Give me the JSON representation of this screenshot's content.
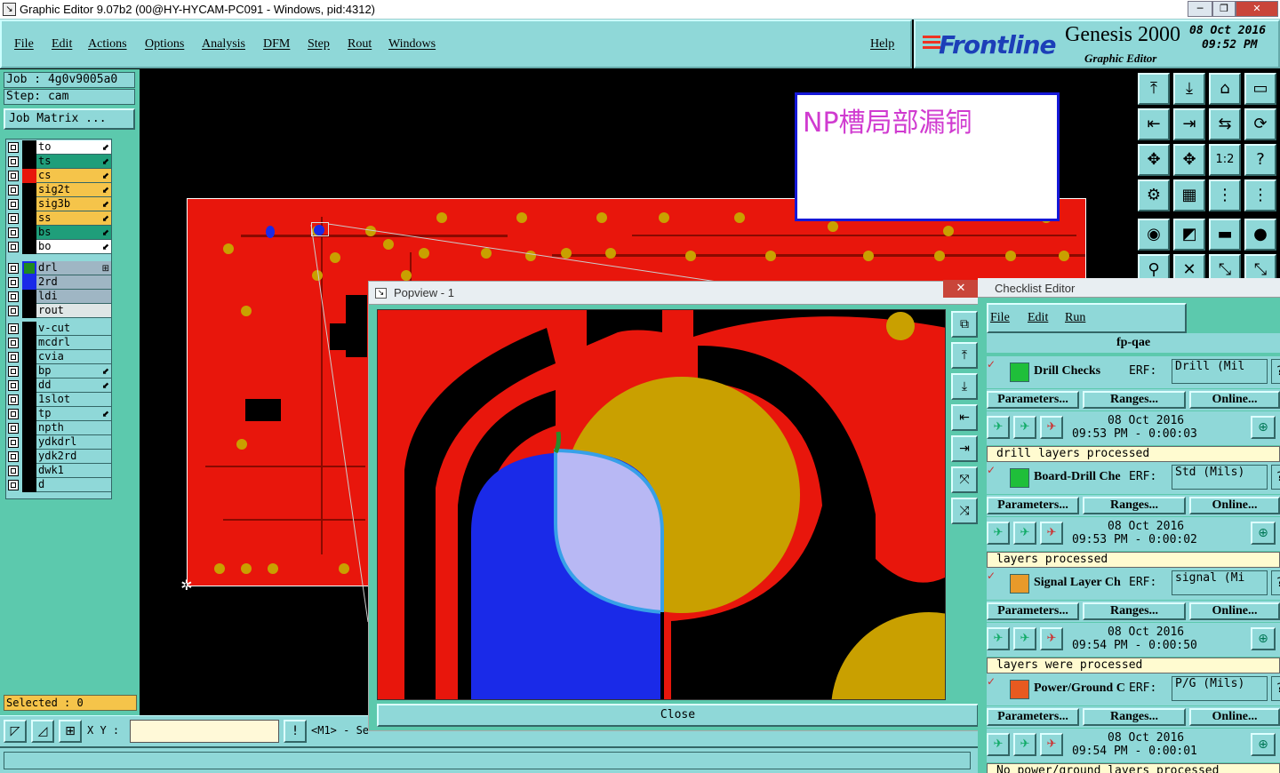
{
  "window": {
    "title": "Graphic Editor 9.07b2 (00@HY-HYCAM-PC091 - Windows, pid:4312)",
    "minimize": "─",
    "maximize": "❐",
    "close": "✕"
  },
  "menu": {
    "items": [
      "File",
      "Edit",
      "Actions",
      "Options",
      "Analysis",
      "DFM",
      "Step",
      "Rout",
      "Windows"
    ],
    "help": "Help"
  },
  "brand": {
    "logo": "Frontline",
    "product": "Genesis 2000",
    "subtitle": "Graphic Editor",
    "date": "08 Oct 2016",
    "time": "09:52 PM"
  },
  "job": {
    "job_label": "Job : 4g0v9005a0",
    "step_label": "Step: cam",
    "matrix_button": "Job Matrix ..."
  },
  "layers": [
    {
      "name": "to",
      "color": "#ffffff",
      "swatch": "#000000",
      "flag": "⬋"
    },
    {
      "name": "ts",
      "color": "#1f9e7a",
      "swatch": "#000000",
      "flag": "⬋"
    },
    {
      "name": "cs",
      "color": "#f5c44a",
      "swatch": "#e8160c",
      "flag": "⬋"
    },
    {
      "name": "sig2t",
      "color": "#f5c44a",
      "swatch": "#000000",
      "flag": "⬋"
    },
    {
      "name": "sig3b",
      "color": "#f5c44a",
      "swatch": "#000000",
      "flag": "⬋"
    },
    {
      "name": "ss",
      "color": "#f5c44a",
      "swatch": "#000000",
      "flag": "⬋"
    },
    {
      "name": "bs",
      "color": "#1f9e7a",
      "swatch": "#000000",
      "flag": "⬋"
    },
    {
      "name": "bo",
      "color": "#ffffff",
      "swatch": "#000000",
      "flag": "⬋"
    },
    {
      "name": "drl",
      "color": "#9fb6c4",
      "swatch": "#1f8a1f",
      "flag": "⊞",
      "active": true
    },
    {
      "name": "2rd",
      "color": "#9fb6c4",
      "swatch": "#1a2ae8",
      "flag": ""
    },
    {
      "name": "ldi",
      "color": "#9fb6c4",
      "swatch": "#000000",
      "flag": ""
    },
    {
      "name": "rout",
      "color": "#dfe6e6",
      "swatch": "#000000",
      "flag": ""
    },
    {
      "name": "v-cut",
      "color": "#8fd8d8",
      "swatch": "#000000",
      "flag": ""
    },
    {
      "name": "mcdrl",
      "color": "#8fd8d8",
      "swatch": "#000000",
      "flag": ""
    },
    {
      "name": "cvia",
      "color": "#8fd8d8",
      "swatch": "#000000",
      "flag": ""
    },
    {
      "name": "bp",
      "color": "#8fd8d8",
      "swatch": "#000000",
      "flag": "⬋"
    },
    {
      "name": "dd",
      "color": "#8fd8d8",
      "swatch": "#000000",
      "flag": "⬋"
    },
    {
      "name": "1slot",
      "color": "#8fd8d8",
      "swatch": "#000000",
      "flag": ""
    },
    {
      "name": "tp",
      "color": "#8fd8d8",
      "swatch": "#000000",
      "flag": "⬋"
    },
    {
      "name": "npth",
      "color": "#8fd8d8",
      "swatch": "#000000",
      "flag": ""
    },
    {
      "name": "ydkdrl",
      "color": "#8fd8d8",
      "swatch": "#000000",
      "flag": ""
    },
    {
      "name": "ydk2rd",
      "color": "#8fd8d8",
      "swatch": "#000000",
      "flag": ""
    },
    {
      "name": "dwk1",
      "color": "#8fd8d8",
      "swatch": "#000000",
      "flag": ""
    },
    {
      "name": "d",
      "color": "#8fd8d8",
      "swatch": "#000000",
      "flag": ""
    }
  ],
  "selected": "Selected : 0",
  "canvas": {
    "note": "NP槽局部漏铜",
    "origin_icon": "✲"
  },
  "bottom": {
    "xy_label": "X Y :",
    "xy_value": "",
    "message": "<M1> - Se",
    "alert_icon": "!"
  },
  "popview": {
    "title": "Popview - 1",
    "close_x": "✕",
    "close_button": "Close",
    "side_icons": [
      "⧉",
      "⤒",
      "⤓",
      "⇤",
      "⇥",
      "⤧",
      "⤨"
    ]
  },
  "toolgrid": {
    "icons": [
      "⤒",
      "⤓",
      "⌂",
      "▭",
      "⇤",
      "⇥",
      "⇆",
      "⟳",
      "✥",
      "✥",
      "1:2",
      "?",
      "⚙",
      "▦",
      "⋮",
      "⋮",
      "◉",
      "◩",
      "▬",
      "●",
      "⚲",
      "✕",
      "⤡",
      "⤡"
    ]
  },
  "checklist": {
    "title": "Checklist Editor",
    "menu": [
      "File",
      "Edit",
      "Run"
    ],
    "name": "fp-qae",
    "erf_label": "ERF:",
    "help": "?",
    "param_label": "Parameters...",
    "range_label": "Ranges...",
    "online_label": "Online...",
    "zoom_icon": "⊕",
    "run_icons": [
      "✈",
      "✈",
      "✈"
    ],
    "items": [
      {
        "name": "Drill Checks",
        "erf": "Drill (Mil",
        "date": "08 Oct 2016",
        "time": "09:53 PM - 0:00:03",
        "result": "drill layers processed",
        "icon_color": "#1fbf3a"
      },
      {
        "name": "Board-Drill Che",
        "erf": "Std (Mils)",
        "date": "08 Oct 2016",
        "time": "09:53 PM - 0:00:02",
        "result": "layers processed",
        "icon_color": "#1fbf3a"
      },
      {
        "name": "Signal Layer Ch",
        "erf": "signal (Mi",
        "date": "08 Oct 2016",
        "time": "09:54 PM - 0:00:50",
        "result": "layers were processed",
        "icon_color": "#e89a2a"
      },
      {
        "name": "Power/Ground C",
        "erf": "P/G (Mils)",
        "date": "08 Oct 2016",
        "time": "09:54 PM - 0:00:01",
        "result": "No power/ground layers processed",
        "icon_color": "#e85a20"
      }
    ]
  },
  "colors": {
    "panel": "#8fd8d8",
    "copper": "#e8160c",
    "pad": "#c9a000",
    "drill": "#1a2ae8"
  }
}
